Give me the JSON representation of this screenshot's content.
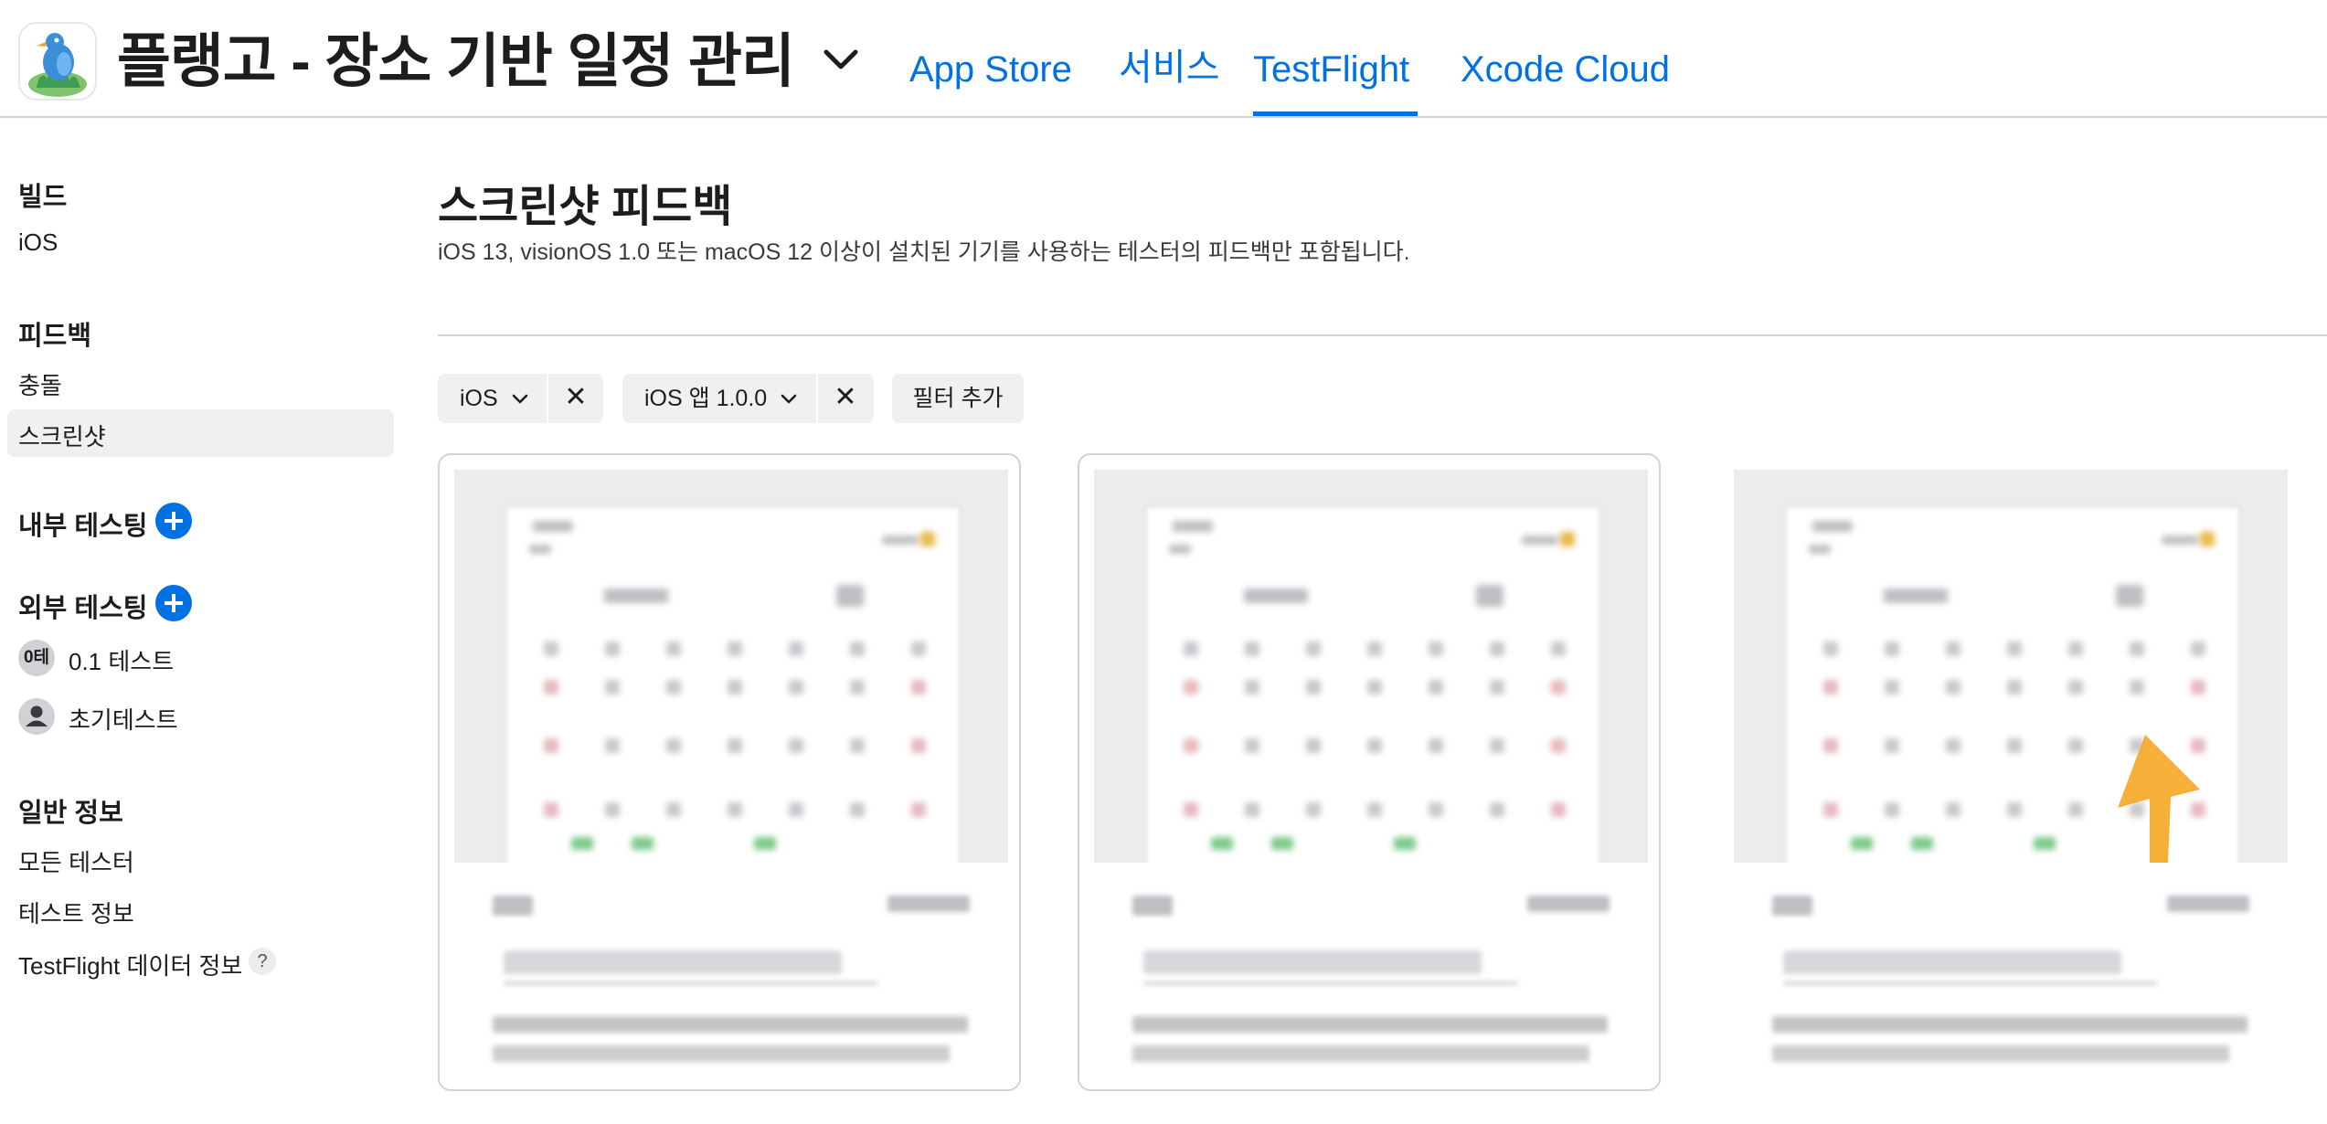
{
  "header": {
    "app_title": "플랭고 - 장소 기반 일정 관리",
    "tabs": [
      {
        "label": "App Store"
      },
      {
        "label": "서비스"
      },
      {
        "label": "TestFlight",
        "active": true
      },
      {
        "label": "Xcode Cloud"
      }
    ]
  },
  "sidebar": {
    "builds": {
      "heading": "빌드",
      "items": [
        "iOS"
      ]
    },
    "feedback": {
      "heading": "피드백",
      "items": [
        "충돌",
        "스크린샷"
      ],
      "selected": "스크린샷"
    },
    "internal_testing": {
      "heading": "내부 테스팅"
    },
    "external_testing": {
      "heading": "외부 테스팅",
      "groups": [
        {
          "avatar": "0테",
          "label": "0.1 테스트"
        },
        {
          "avatar": "person-icon",
          "label": "초기테스트"
        }
      ]
    },
    "general": {
      "heading": "일반 정보",
      "items": [
        "모든 테스터",
        "테스트 정보",
        "TestFlight 데이터 정보"
      ],
      "help": "?"
    }
  },
  "main": {
    "title": "스크린샷 피드백",
    "subtitle": "iOS 13, visionOS 1.0 또는 macOS 12 이상이 설치된 기기를 사용하는 테스터의 피드백만 포함됩니다.",
    "filters": [
      {
        "label": "iOS",
        "remove": "✕"
      },
      {
        "label": "iOS 앱 1.0.0",
        "remove": "✕"
      }
    ],
    "add_filter": "필터 추가",
    "cards_count_visible": 3
  },
  "colors": {
    "accent": "#0071e3",
    "text": "#1d1d1f",
    "chip_bg": "#f0f0f2",
    "divider": "#d2d2d7",
    "annotation_arrow": "#f5a623"
  }
}
